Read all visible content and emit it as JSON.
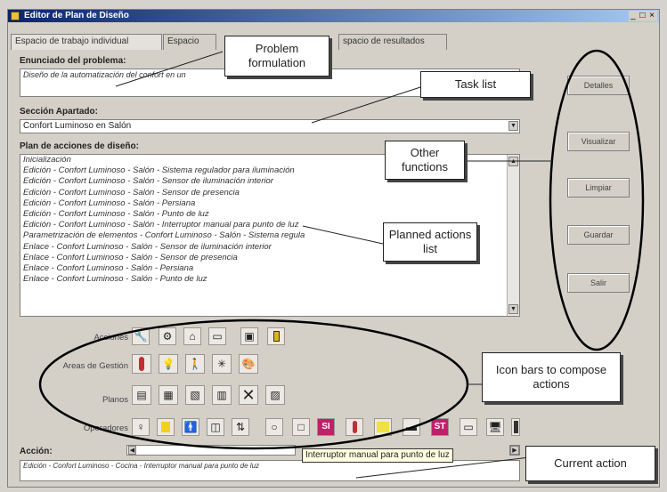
{
  "window": {
    "title": "Editor de Plan de Diseño",
    "controls": "_ □ ×"
  },
  "tabs": [
    {
      "label": "Espacio de trabajo individual"
    },
    {
      "label": "Espacio"
    },
    {
      "label": "spacio de resultados"
    }
  ],
  "problem": {
    "label": "Enunciado del problema:",
    "value": "Diseño de la automatización del confort en un"
  },
  "section": {
    "label": "Sección Apartado:",
    "value": "Confort Luminoso en Salón"
  },
  "plan": {
    "label": "Plan de acciones de diseño:",
    "items": [
      "Inicialización",
      "Edición - Confort Luminoso - Salón - Sistema regulador para iluminación",
      "Edición - Confort Luminoso - Salón - Sensor de iluminación interior",
      "Edición - Confort Luminoso - Salón - Sensor de presencia",
      "Edición - Confort Luminoso - Salón - Persiana",
      "Edición - Confort Luminoso - Salón - Punto de luz",
      "Edición - Confort Luminoso - Salón - Interruptor manual para punto de luz",
      "Parametrización de elementos - Confort Luminoso - Salón - Sistema regula",
      "Enlace - Confort Luminoso - Salón - Sensor de iluminación interior",
      "Enlace - Confort Luminoso - Salón - Sensor de presencia",
      "Enlace - Confort Luminoso - Salón - Persiana",
      "Enlace - Confort Luminoso - Salón - Punto de luz"
    ]
  },
  "side_buttons": [
    "Detalles",
    "Visualizar",
    "Limpiar",
    "Guardar",
    "Salir"
  ],
  "icon_rows": {
    "acciones": {
      "label": "Acciones",
      "icons": [
        "wrench-icon",
        "gear-icon",
        "house-icon",
        "window-icon",
        "panel-icon",
        "door-icon"
      ]
    },
    "areas": {
      "label": "Areas de Gestión",
      "icons": [
        "thermometer-icon",
        "lightbulb-panel-icon",
        "person-door-icon",
        "network-icon",
        "palette-icon"
      ]
    },
    "planos": {
      "label": "Planos",
      "icons": [
        "floorplan-1-icon",
        "floorplan-2-icon",
        "floorplan-3-icon",
        "floorplan-4-icon",
        "cross-icon",
        "blueprint-icon"
      ]
    },
    "operadores": {
      "label": "Operadores",
      "icons": [
        "sensor-icon",
        "light-icon",
        "presence-icon",
        "blind-icon",
        "switch-icon",
        "bulb-icon",
        "box-icon",
        "si-icon",
        "thermo-icon",
        "yellow-panel-icon",
        "grid-icon",
        "st-icon",
        "monitor-icon",
        "computer-icon",
        "battery-icon"
      ]
    }
  },
  "badges": {
    "si": "SI",
    "st": "ST"
  },
  "action": {
    "label": "Acción:",
    "value": "Edición - Confort Luminoso - Cocina - Interruptor manual para punto de luz",
    "tooltip": "Interruptor manual para punto de luz"
  },
  "callouts": {
    "problem": "Problem formulation",
    "task": "Task list",
    "other": "Other functions",
    "planned": "Planned actions list",
    "iconbars": "Icon bars to compose actions",
    "current": "Current action"
  },
  "colors": {
    "titlebar": "#0a246a",
    "si_badge": "#c0206a",
    "st_badge": "#c0206a"
  }
}
